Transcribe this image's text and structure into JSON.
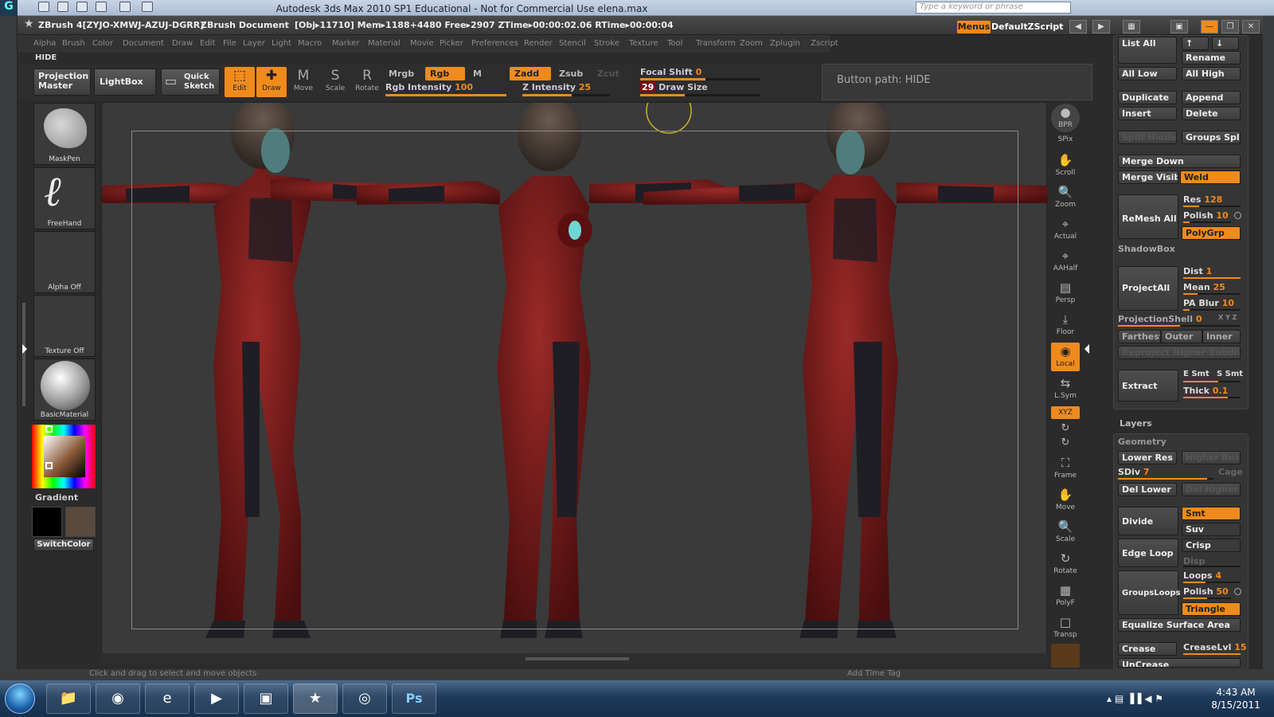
{
  "max": {
    "title": "Autodesk 3ds Max 2010 SP1   Educational - Not for Commercial Use      elena.max",
    "search_placeholder": "Type a keyword or phrase"
  },
  "zbrush": {
    "version": "ZBrush 4[ZYJO-XMWJ-AZUJ-DGRR]",
    "document": "ZBrush Document",
    "stats": "[Obj▸11710] Mem▸1188+4480  Free▸2907  ZTime▸00:00:02.06  RTime▸00:00:04",
    "menus_btn": "Menus",
    "script": "DefaultZScript"
  },
  "menu": [
    "Alpha",
    "Brush",
    "Color",
    "Document",
    "Draw",
    "Edit",
    "File",
    "Layer",
    "Light",
    "Macro",
    "Marker",
    "Material",
    "Movie",
    "Picker",
    "Preferences",
    "Render",
    "Stencil",
    "Stroke",
    "Texture",
    "Tool",
    "Transform",
    "Zoom",
    "Zplugin",
    "Zscript"
  ],
  "hide_label": "HIDE",
  "toolbar": {
    "projection_master": "Projection Master",
    "lightbox": "LightBox",
    "quick_sketch": "Quick Sketch",
    "edit": "Edit",
    "draw": "Draw",
    "move": "Move",
    "scale": "Scale",
    "rotate": "Rotate",
    "mrgb": "Mrgb",
    "rgb": "Rgb",
    "m": "M",
    "zadd": "Zadd",
    "zsub": "Zsub",
    "zcut": "Zcut",
    "rgb_intensity_label": "Rgb Intensity",
    "rgb_intensity": "100",
    "z_intensity_label": "Z Intensity",
    "z_intensity": "25",
    "focal_shift_label": "Focal Shift",
    "focal_shift": "0",
    "draw_size_label": "Draw Size",
    "draw_size": "29"
  },
  "tooltip": "Button path: HIDE",
  "left_shelf": {
    "brush": "MaskPen",
    "stroke": "FreeHand",
    "alpha": "Alpha  Off",
    "texture": "Texture  Off",
    "material": "BasicMaterial",
    "gradient": "Gradient",
    "switch": "SwitchColor"
  },
  "right_tools": [
    "SPix",
    "Scroll",
    "Zoom",
    "Actual",
    "AAHalf",
    "Persp",
    "Floor",
    "Local",
    "L.Sym",
    "XYZ",
    "Frame",
    "Move",
    "Scale",
    "Rotate",
    "PolyF",
    "Transp"
  ],
  "right_tools_top": "BPR",
  "tool_panel": {
    "list_all": "List  All",
    "rename": "Rename",
    "all_low": "All  Low",
    "all_high": "All  High",
    "duplicate": "Duplicate",
    "append": "Append",
    "insert": "Insert",
    "delete": "Delete",
    "split_hidden": "Split  Hidden",
    "groups_split": "Groups  Split",
    "merge_down": "Merge  Down",
    "merge_visible": "Merge  Visible",
    "weld": "Weld",
    "remesh_all": "ReMesh  All",
    "res_label": "Res",
    "res": "128",
    "polish_label": "Polish",
    "polish": "10",
    "polygrp": "PolyGrp",
    "shadowbox": "ShadowBox",
    "projectall": "ProjectAll",
    "dist_label": "Dist",
    "dist": "1",
    "mean_label": "Mean",
    "mean": "25",
    "pablur_label": "PA  Blur",
    "pablur": "10",
    "projshell_label": "ProjectionShell",
    "projshell": "0",
    "xyz": "X Y Z",
    "farthest": "Farthest",
    "outer": "Outer",
    "inner": "Inner",
    "reproject": "Reproject  Higher  Subdiv",
    "extract": "Extract",
    "esmt": "E  Smt",
    "ssmt": "S  Smt",
    "thick_label": "Thick",
    "thick": "0.1",
    "layers": "Layers",
    "geometry": "Geometry",
    "lower_res": "Lower  Res",
    "higher_res": "Higher  Res",
    "sdiv_label": "SDiv",
    "sdiv": "7",
    "cage": "Cage",
    "del_lower": "Del  Lower",
    "del_higher": "Del  Higher",
    "divide": "Divide",
    "smt": "Smt",
    "suv": "Suv",
    "edge_loop": "Edge  Loop",
    "crisp": "Crisp",
    "disp": "Disp",
    "groupsloops": "GroupsLoops",
    "loops_label": "Loops",
    "loops": "4",
    "polish2_label": "Polish",
    "polish2": "50",
    "triangle": "Triangle",
    "equalize": "Equalize  Surface  Area",
    "crease": "Crease",
    "creaselvl_label": "CreaseLvl",
    "creaselvl": "15",
    "uncrease": "UnCrease"
  },
  "status": {
    "hint": "Click and drag to select and move objects",
    "add_time_tag": "Add Time Tag"
  },
  "taskbar": {
    "time": "4:43 AM",
    "date": "8/15/2011",
    "apps": [
      "folder",
      "firefox",
      "ie",
      "media-player",
      "3dsmax",
      "zbrush",
      "qt",
      "photoshop"
    ],
    "ps": "Ps"
  },
  "colors": {
    "accent": "#f08a1c",
    "suit": "#7a1a1a",
    "dark": "#1e1e24"
  }
}
